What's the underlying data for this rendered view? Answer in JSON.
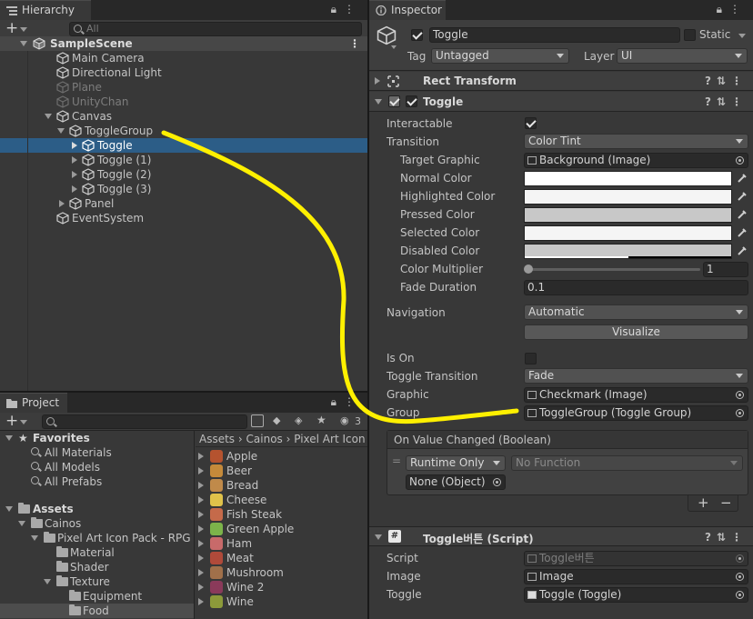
{
  "hierarchy": {
    "tab": "Hierarchy",
    "search_placeholder": "All",
    "scene": "SampleScene",
    "items": [
      {
        "label": "Main Camera"
      },
      {
        "label": "Directional Light"
      },
      {
        "label": "Plane"
      },
      {
        "label": "UnityChan"
      },
      {
        "label": "Canvas"
      },
      {
        "label": "ToggleGroup"
      },
      {
        "label": "Toggle"
      },
      {
        "label": "Toggle (1)"
      },
      {
        "label": "Toggle (2)"
      },
      {
        "label": "Toggle (3)"
      },
      {
        "label": "Panel"
      },
      {
        "label": "EventSystem"
      }
    ]
  },
  "project": {
    "tab": "Project",
    "badge": "3",
    "favorites": {
      "label": "Favorites",
      "items": [
        "All Materials",
        "All Models",
        "All Prefabs"
      ]
    },
    "assets": {
      "label": "Assets",
      "tree": [
        "Cainos",
        "Pixel Art Icon Pack - RPG",
        "Material",
        "Shader",
        "Texture",
        "Equipment",
        "Food"
      ]
    },
    "breadcrumb": [
      "Assets",
      "Cainos",
      "Pixel Art Icon"
    ],
    "files": [
      "Apple",
      "Beer",
      "Bread",
      "Cheese",
      "Fish Steak",
      "Green Apple",
      "Ham",
      "Meat",
      "Mushroom",
      "Wine 2",
      "Wine"
    ],
    "file_colors": [
      "#b5532f",
      "#c58a3a",
      "#c08a4a",
      "#e0c24a",
      "#c56a4a",
      "#7cb34a",
      "#c86a6a",
      "#b04a3a",
      "#a0704a",
      "#8a3a5a",
      "#8c9a3a"
    ]
  },
  "inspector": {
    "tab": "Inspector",
    "object_name": "Toggle",
    "static_label": "Static",
    "tag_label": "Tag",
    "tag_value": "Untagged",
    "layer_label": "Layer",
    "layer_value": "UI",
    "rect_transform": "Rect Transform",
    "toggle_component": "Toggle",
    "props": {
      "interactable": "Interactable",
      "transition": "Transition",
      "transition_value": "Color Tint",
      "target_graphic": "Target Graphic",
      "target_graphic_value": "Background (Image)",
      "normal_color": "Normal Color",
      "highlighted_color": "Highlighted Color",
      "pressed_color": "Pressed Color",
      "selected_color": "Selected Color",
      "disabled_color": "Disabled Color",
      "color_multiplier": "Color Multiplier",
      "color_multiplier_value": "1",
      "fade_duration": "Fade Duration",
      "fade_duration_value": "0.1",
      "navigation": "Navigation",
      "navigation_value": "Automatic",
      "visualize": "Visualize",
      "is_on": "Is On",
      "toggle_transition": "Toggle Transition",
      "toggle_transition_value": "Fade",
      "graphic": "Graphic",
      "graphic_value": "Checkmark (Image)",
      "group": "Group",
      "group_value": "ToggleGroup (Toggle Group)",
      "event_title": "On Value Changed (Boolean)",
      "runtime": "Runtime Only",
      "no_function": "No Function",
      "none_object": "None (Object)"
    },
    "colors": {
      "normal": "#ffffff",
      "highlighted": "#f5f5f5",
      "pressed": "#c8c8c8",
      "selected": "#f5f5f5",
      "disabled": "#c8c8c8"
    },
    "script_component": "Toggle버튼 (Script)",
    "script_props": {
      "script": "Script",
      "script_value": "Toggle버튼",
      "image": "Image",
      "image_value": "Image",
      "toggle": "Toggle",
      "toggle_value": "Toggle (Toggle)"
    }
  }
}
